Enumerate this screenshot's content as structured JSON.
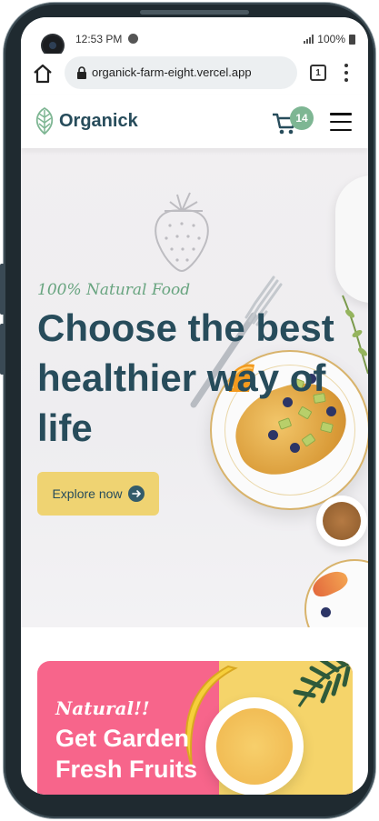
{
  "status_bar": {
    "time": "12:53 PM",
    "battery": "100%",
    "icons": [
      "spotify-icon",
      "signal-icon",
      "battery-icon"
    ]
  },
  "browser": {
    "url": "organick-farm-eight.vercel.app",
    "tab_count": "1",
    "icons": [
      "home-icon",
      "lock-icon",
      "tabs-icon",
      "menu-dots-icon"
    ]
  },
  "header": {
    "logo_text": "Organick",
    "cart_count": "14",
    "icons": [
      "logo-leaf-icon",
      "cart-icon",
      "hamburger-menu-icon"
    ]
  },
  "hero": {
    "tagline": "100% Natural Food",
    "title": "Choose the best healthier way of life",
    "button_label": "Explore now"
  },
  "promo": {
    "tagline": "Natural!!",
    "title": "Get Garden Fresh Fruits"
  },
  "colors": {
    "brand_dark": "#274c5b",
    "brand_green": "#7eb693",
    "tag_green": "#68a47f",
    "button_yellow": "#efd372",
    "promo_pink": "#f7658b",
    "promo_yellow": "#f5d46a"
  }
}
